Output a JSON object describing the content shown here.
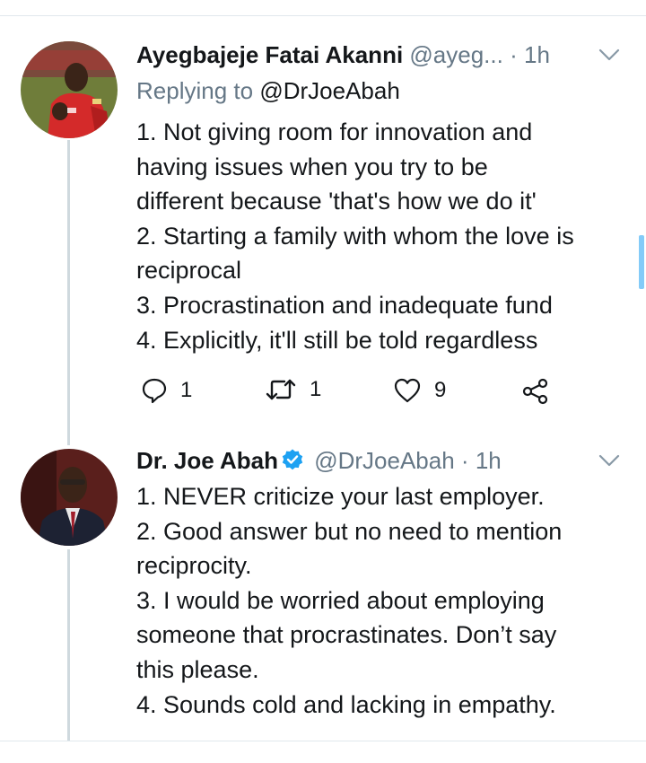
{
  "tweet1": {
    "name": "Ayegbajeje Fatai Akanni",
    "handle": "@ayeg...",
    "dot": "·",
    "time": "1h",
    "replying_prefix": "Replying to",
    "replying_to": "@DrJoeAbah",
    "lines": [
      "1. Not giving room for innovation and",
      "having issues when you try to be",
      "different because 'that's how we do it'",
      "2. Starting a family with whom the love is",
      "reciprocal",
      "3. Procrastination and inadequate fund",
      "4. Explicitly, it'll still be told regardless"
    ],
    "actions": {
      "replies": "1",
      "retweets": "1",
      "likes": "9"
    },
    "avatar_icon": "avatar-photo"
  },
  "tweet2": {
    "name": "Dr. Joe Abah",
    "verified_icon": "verified-badge-icon",
    "handle": "@DrJoeAbah",
    "dot": "·",
    "time": "1h",
    "lines": [
      "1. NEVER criticize your last employer.",
      "2. Good answer but no need to mention",
      "reciprocity.",
      "3. I would be worried about employing",
      "someone that procrastinates. Don’t say",
      "this please.",
      "4. Sounds cold and lacking in empathy."
    ],
    "avatar_icon": "avatar-photo"
  },
  "colors": {
    "accent": "#1da1f2",
    "secondary_text": "#657786",
    "thread_line": "#cfd9de",
    "divider": "#e1e8ed"
  }
}
